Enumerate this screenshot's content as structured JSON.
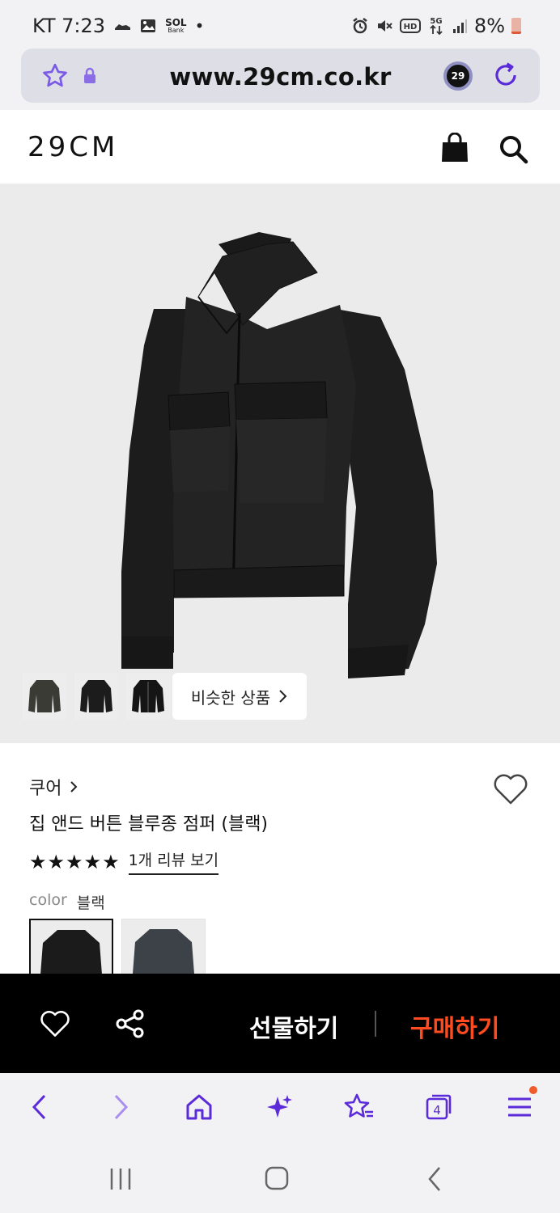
{
  "status_bar": {
    "carrier_time": "KT 7:23",
    "dot": "•",
    "battery": "8%",
    "sol_label": "SOL",
    "sol_sub": "Bank"
  },
  "address_bar": {
    "url": "www.29cm.co.kr",
    "site_badge": "29"
  },
  "header": {
    "logo": "29CM"
  },
  "product_image": {
    "thumbnails": [
      "green-jacket-thumb",
      "black-jacket-thumb",
      "black-bomber-thumb"
    ],
    "similar_button": "비슷한 상품"
  },
  "product": {
    "brand": "쿠어",
    "title": "집 앤드 버튼 블루종 점퍼 (블랙)",
    "rating": 5,
    "stars": "★★★★★",
    "review_link": "1개 리뷰 보기",
    "color_label": "color",
    "color_value": "블랙",
    "color_swatches": [
      "black",
      "charcoal"
    ]
  },
  "action_bar": {
    "gift": "선물하기",
    "buy": "구매하기"
  },
  "browser_nav": {
    "tab_count": "4"
  },
  "colors": {
    "accent_purple": "#5b2bd9",
    "buy_orange": "#ff4b1f"
  }
}
